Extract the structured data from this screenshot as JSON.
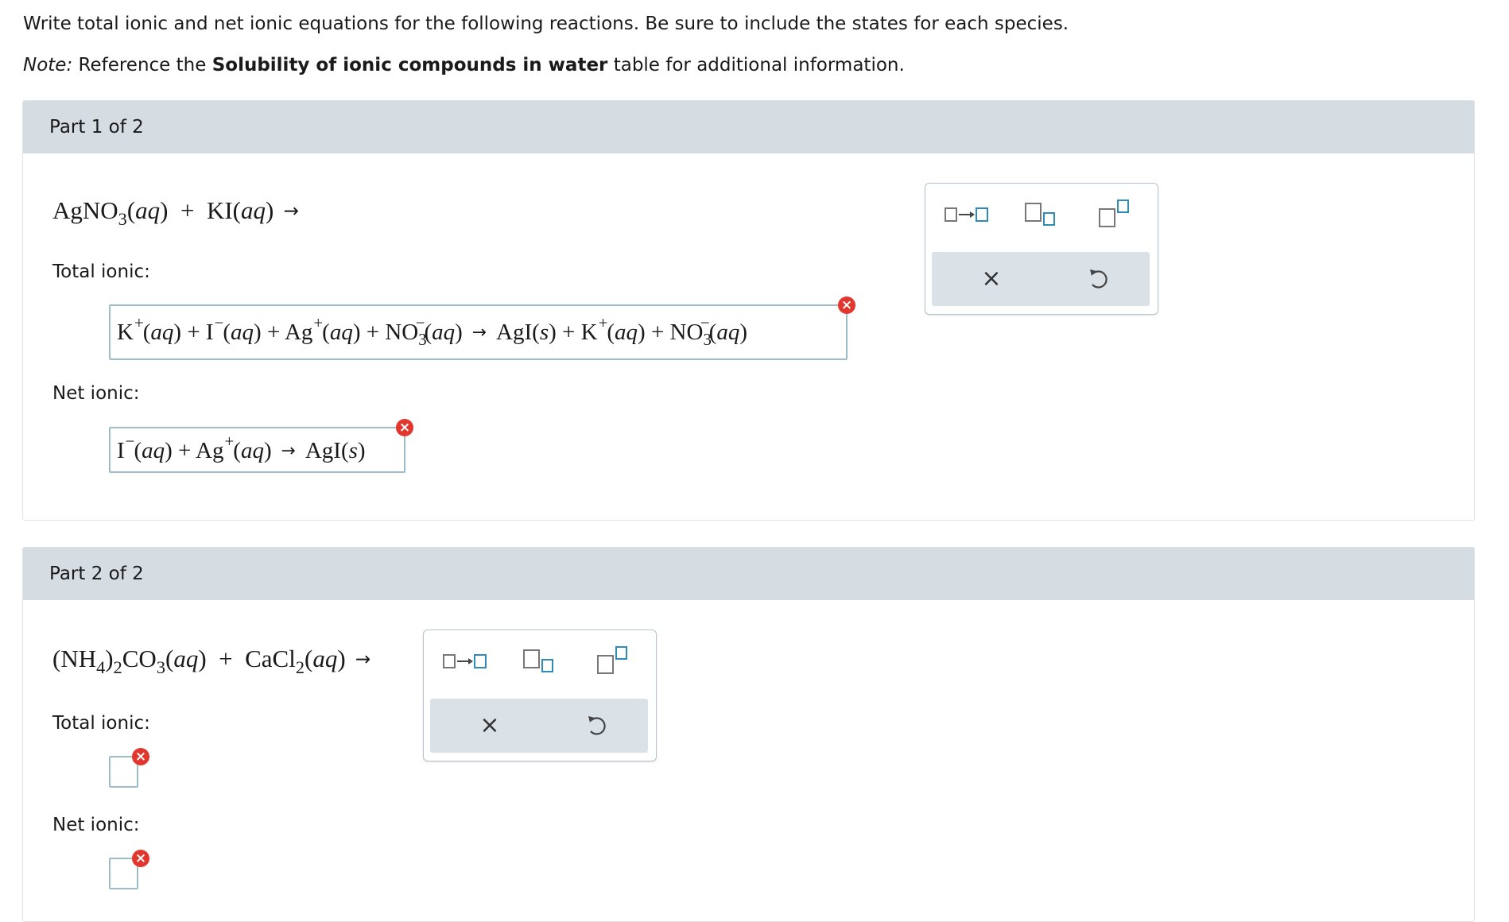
{
  "instructions": "Write total ionic and net ionic equations for the following reactions. Be sure to include the states for each species.",
  "note": {
    "prefix": "Note:",
    "text_before": " Reference the ",
    "bold": "Solubility of ionic compounds in water",
    "text_after": " table for additional information."
  },
  "parts": [
    {
      "title": "Part 1 of 2",
      "total_label": "Total ionic:",
      "net_label": "Net ionic:"
    },
    {
      "title": "Part 2 of 2",
      "total_label": "Total ionic:",
      "net_label": "Net ionic:"
    }
  ],
  "toolbar": {
    "buttons": [
      "arrow-template-icon",
      "subscript-template-icon",
      "superscript-template-icon"
    ],
    "clear_icon": "×",
    "undo_icon": "undo-icon"
  },
  "error_icon": "×",
  "colors": {
    "part_header": "#d5dde2",
    "answer_border": "#9cbcca",
    "error": "#e1372e",
    "template_blue": "#2f8cb8"
  }
}
